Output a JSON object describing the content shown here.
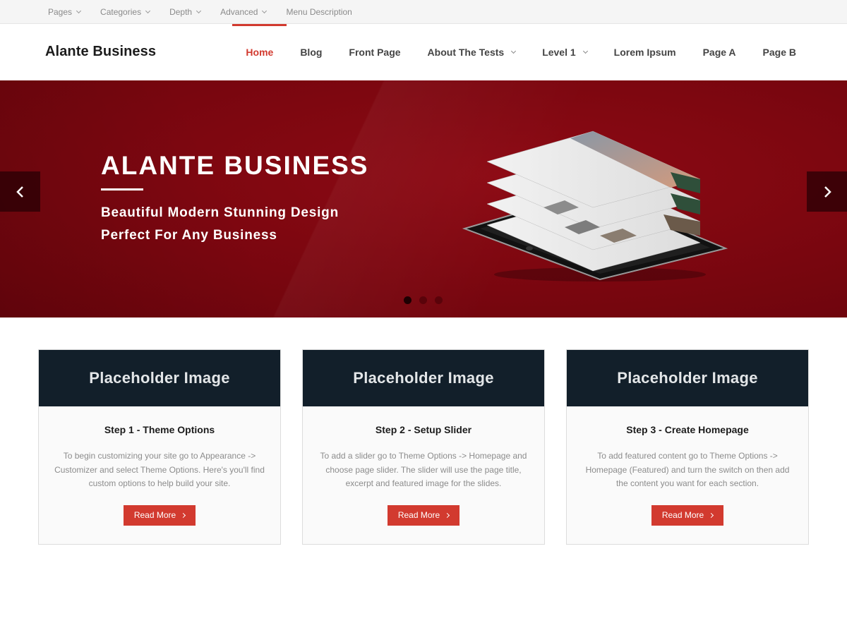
{
  "topbar": {
    "items": [
      {
        "label": "Pages",
        "has_dropdown": true
      },
      {
        "label": "Categories",
        "has_dropdown": true
      },
      {
        "label": "Depth",
        "has_dropdown": true
      },
      {
        "label": "Advanced",
        "has_dropdown": true
      },
      {
        "label": "Menu Description",
        "has_dropdown": false
      }
    ]
  },
  "header": {
    "logo": "Alante Business",
    "nav": [
      {
        "label": "Home",
        "active": true
      },
      {
        "label": "Blog"
      },
      {
        "label": "Front Page"
      },
      {
        "label": "About The Tests",
        "has_dropdown": true
      },
      {
        "label": "Level 1",
        "has_dropdown": true
      },
      {
        "label": "Lorem Ipsum"
      },
      {
        "label": "Page A"
      },
      {
        "label": "Page B"
      }
    ]
  },
  "hero": {
    "title": "ALANTE BUSINESS",
    "subtitle_line1": "Beautiful Modern Stunning Design",
    "subtitle_line2": "Perfect For Any Business",
    "slide_count": 3,
    "active_slide": 1,
    "prev_icon": "chevron-left-icon",
    "next_icon": "chevron-right-icon"
  },
  "cards": [
    {
      "image_text": "Placeholder Image",
      "title": "Step 1 - Theme Options",
      "text": "To begin customizing your site go to Appearance -> Customizer and select Theme Options. Here's you'll find custom options to help build your site.",
      "button": "Read More"
    },
    {
      "image_text": "Placeholder Image",
      "title": "Step 2 - Setup Slider",
      "text": "To add a slider go to Theme Options -> Homepage and choose page slider. The slider will use the page title, excerpt and featured image for the slides.",
      "button": "Read More"
    },
    {
      "image_text": "Placeholder Image",
      "title": "Step 3 - Create Homepage",
      "text": "To add featured content go to Theme Options -> Homepage (Featured) and turn the switch on then add the content you want for each section.",
      "button": "Read More"
    }
  ],
  "colors": {
    "accent": "#d23a2f",
    "hero_bg": "#7e0710",
    "card_image_bg": "#121f2a"
  }
}
